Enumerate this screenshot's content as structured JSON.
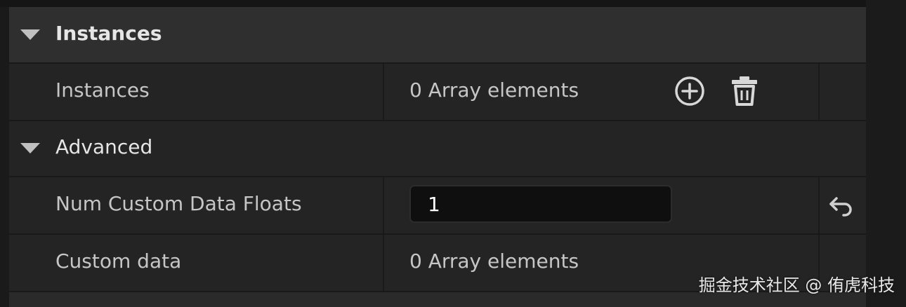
{
  "categories": {
    "instances": {
      "label": "Instances"
    },
    "advanced": {
      "label": "Advanced"
    }
  },
  "properties": {
    "instances": {
      "name": "Instances",
      "value": "0 Array elements"
    },
    "num_custom_data_floats": {
      "name": "Num Custom Data Floats",
      "value": "1"
    },
    "custom_data": {
      "name": "Custom data",
      "value": "0 Array elements"
    }
  },
  "icons": {
    "add": "add-element-icon",
    "delete": "delete-all-icon",
    "reset": "reset-to-default-icon",
    "collapse": "caret-down-icon"
  },
  "colors": {
    "panel_bg": "#242424",
    "category_bg": "#2f2f2f",
    "input_bg": "#0f0f0f",
    "text": "#c6c6c6"
  },
  "watermark": "掘金技术社区 @ 侑虎科技"
}
